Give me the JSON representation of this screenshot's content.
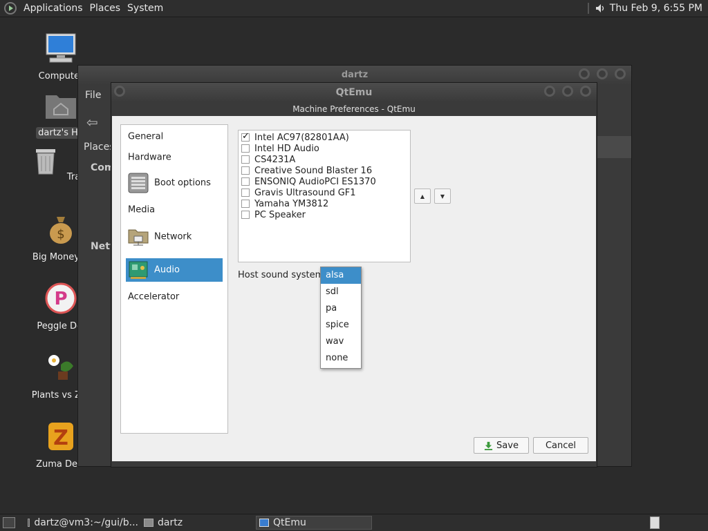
{
  "top_panel": {
    "menus": [
      "Applications",
      "Places",
      "System"
    ],
    "clock": "Thu Feb  9,  6:55 PM"
  },
  "desktop": {
    "icons": [
      {
        "label": "Computer",
        "icon": "computer-icon"
      },
      {
        "label": "dartz's Ho",
        "icon": "home-folder-icon"
      },
      {
        "label": "Trash",
        "icon": "trash-icon"
      },
      {
        "label": "Big Money D",
        "icon": "money-bag-icon"
      },
      {
        "label": "Peggle Del",
        "icon": "peggle-icon"
      },
      {
        "label": "Plants vs Zor",
        "icon": "plants-icon"
      },
      {
        "label": "Zuma Delu",
        "icon": "zuma-icon"
      }
    ]
  },
  "file_window": {
    "title": "dartz",
    "menu_file": "File",
    "places": "Places",
    "side_comp": "Comp",
    "side_netw": "Netw"
  },
  "qtemu_window": {
    "title": "QtEmu"
  },
  "dialog": {
    "title": "Machine Preferences - QtEmu",
    "nav": [
      {
        "label": "General"
      },
      {
        "label": "Hardware"
      },
      {
        "label": "Boot options",
        "icon": "boot-options-icon"
      },
      {
        "label": "Media"
      },
      {
        "label": "Network",
        "icon": "network-icon"
      },
      {
        "label": "Audio",
        "icon": "audio-card-icon"
      },
      {
        "label": "Accelerator"
      }
    ],
    "sound_cards": [
      {
        "label": "Intel AC97(82801AA)",
        "checked": true
      },
      {
        "label": "Intel HD Audio",
        "checked": false
      },
      {
        "label": "CS4231A",
        "checked": false
      },
      {
        "label": "Creative Sound Blaster 16",
        "checked": false
      },
      {
        "label": "ENSONIQ AudioPCI ES1370",
        "checked": false
      },
      {
        "label": "Gravis Ultrasound GF1",
        "checked": false
      },
      {
        "label": "Yamaha YM3812",
        "checked": false
      },
      {
        "label": "PC Speaker",
        "checked": false
      }
    ],
    "host_sound_label": "Host sound system:",
    "host_sound_options": [
      "alsa",
      "sdl",
      "pa",
      "spice",
      "wav",
      "none"
    ],
    "host_sound_selected": "alsa",
    "save_label": "Save",
    "cancel_label": "Cancel"
  },
  "bottom_panel": {
    "tasks": [
      {
        "label": "dartz@vm3:~/gui/b...",
        "icon": "terminal-icon"
      },
      {
        "label": "dartz",
        "icon": "folder-icon"
      },
      {
        "label": "QtEmu",
        "icon": "qtemu-icon"
      }
    ]
  },
  "colors": {
    "selection": "#3d8ec9",
    "panel": "#2e2e2e"
  }
}
